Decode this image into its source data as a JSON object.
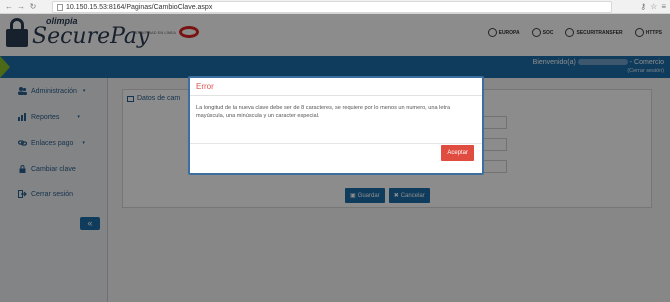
{
  "browser": {
    "url": "10.150.15.53:8164/Paginas/CambioClave.aspx"
  },
  "header": {
    "logo_small": "olimpia",
    "logo_big": "SecurePay",
    "partner_text": "IDENTIDAD EN LÍNEA",
    "badges": [
      "EUROPA",
      "SOC",
      "SECURITRANSFER",
      "HTTPS"
    ]
  },
  "topbar": {
    "welcome": "Bienvenido(a)",
    "role": "Comercio",
    "logout": "(Cerrar sesión)"
  },
  "sidebar": {
    "items": [
      {
        "label": "Administración",
        "icon": "users-icon",
        "has_caret": true
      },
      {
        "label": "Reportes",
        "icon": "chart-icon",
        "has_caret": true
      },
      {
        "label": "Enlaces pago",
        "icon": "link-icon",
        "has_caret": true
      },
      {
        "label": "Cambiar clave",
        "icon": "lock-icon",
        "has_caret": false
      },
      {
        "label": "Cerrar sesión",
        "icon": "logout-icon",
        "has_caret": false
      }
    ],
    "collapse": "«"
  },
  "panel": {
    "title": "Datos de cam"
  },
  "buttons": {
    "save": "Guardar",
    "cancel": "Cancelar"
  },
  "modal": {
    "title": "Error",
    "message": "La longitud de la nueva clave debe ser de 8 caracteres, se requiere por lo menos un numero, una letra mayúscula, una minúscula y un caracter especial.",
    "accept": "Aceptar"
  },
  "colors": {
    "primary": "#1c6ea8",
    "accent_green": "#8bbf2c",
    "error": "#d9534f",
    "accept_button": "#e04c3f"
  }
}
